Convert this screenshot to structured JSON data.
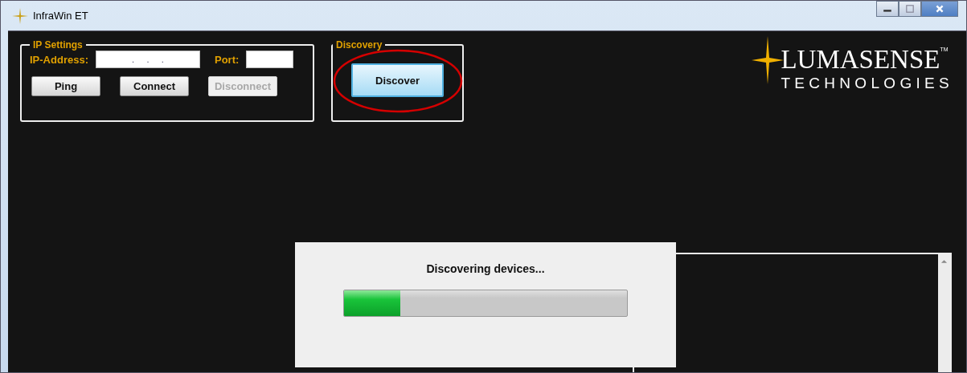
{
  "window": {
    "title": "InfraWin ET"
  },
  "ip_settings": {
    "title": "IP Settings",
    "ip_label": "IP-Address:",
    "ip_value": ".     .     .",
    "port_label": "Port:",
    "buttons": [
      {
        "label": "Ping",
        "disabled": false
      },
      {
        "label": "Connect",
        "disabled": false
      },
      {
        "label": "Disconnect",
        "disabled": true
      }
    ]
  },
  "discovery": {
    "title": "Discovery",
    "button": {
      "label": "Discover",
      "highlighted": true
    }
  },
  "logo": {
    "name": "LUMASENSE",
    "tm": "TM",
    "subtitle": "TECHNOLOGIES"
  },
  "progress_dialog": {
    "message": "Discovering devices...",
    "level": 0.2
  }
}
